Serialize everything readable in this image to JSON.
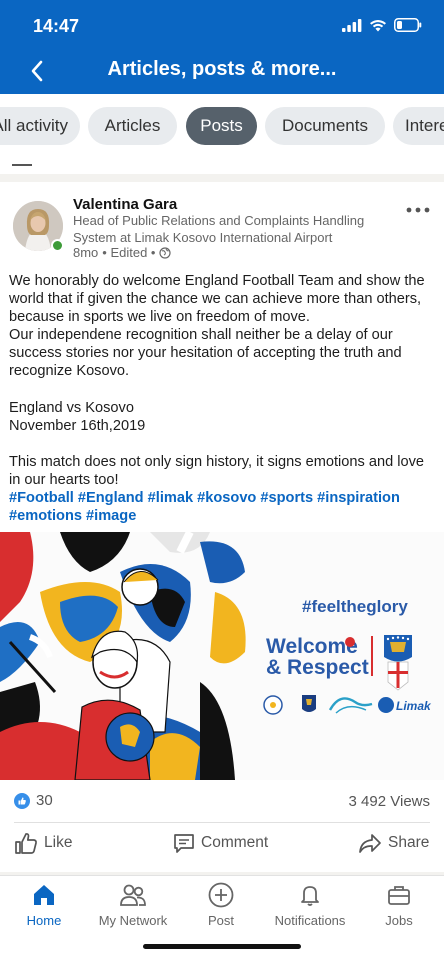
{
  "status_bar": {
    "time": "14:47"
  },
  "header": {
    "title": "Articles, posts & more..."
  },
  "tabs": [
    {
      "label": "All activity"
    },
    {
      "label": "Articles"
    },
    {
      "label": "Posts"
    },
    {
      "label": "Documents"
    },
    {
      "label": "Interests"
    }
  ],
  "post": {
    "author": "Valentina Gara",
    "headline": "Head of Public Relations and Complaints Handling System at Limak Kosovo International Airport",
    "time_ago": "8mo",
    "edited": "• Edited •",
    "body": [
      "We honorably do welcome England Football Team and show the world that if given the chance we can achieve more than others, because in sports we live on freedom of move.",
      "Our independene recognition shall neither be a delay of our success stories nor your hesitation of accepting the truth and recognize Kosovo.",
      "England vs Kosovo",
      "November 16th,2019",
      "This match does not only sign history, it signs emotions and love in our hearts too!"
    ],
    "hashtags": "#Football #England #limak #kosovo #sports #inspiration #emotions #image",
    "image": {
      "tagline": "#feeltheglory",
      "welcome_line1": "Welcome",
      "welcome_line2": "& Respect",
      "sponsor": "Limak"
    },
    "reactions": "30",
    "views": "3 492 Views",
    "actions": {
      "like": "Like",
      "comment": "Comment",
      "share": "Share"
    }
  },
  "bottom_nav": [
    {
      "label": "Home"
    },
    {
      "label": "My Network"
    },
    {
      "label": "Post"
    },
    {
      "label": "Notifications"
    },
    {
      "label": "Jobs"
    }
  ],
  "colors": {
    "brand": "#0a66c2",
    "active_tab": "#56616b",
    "presence": "#3d9b38"
  }
}
